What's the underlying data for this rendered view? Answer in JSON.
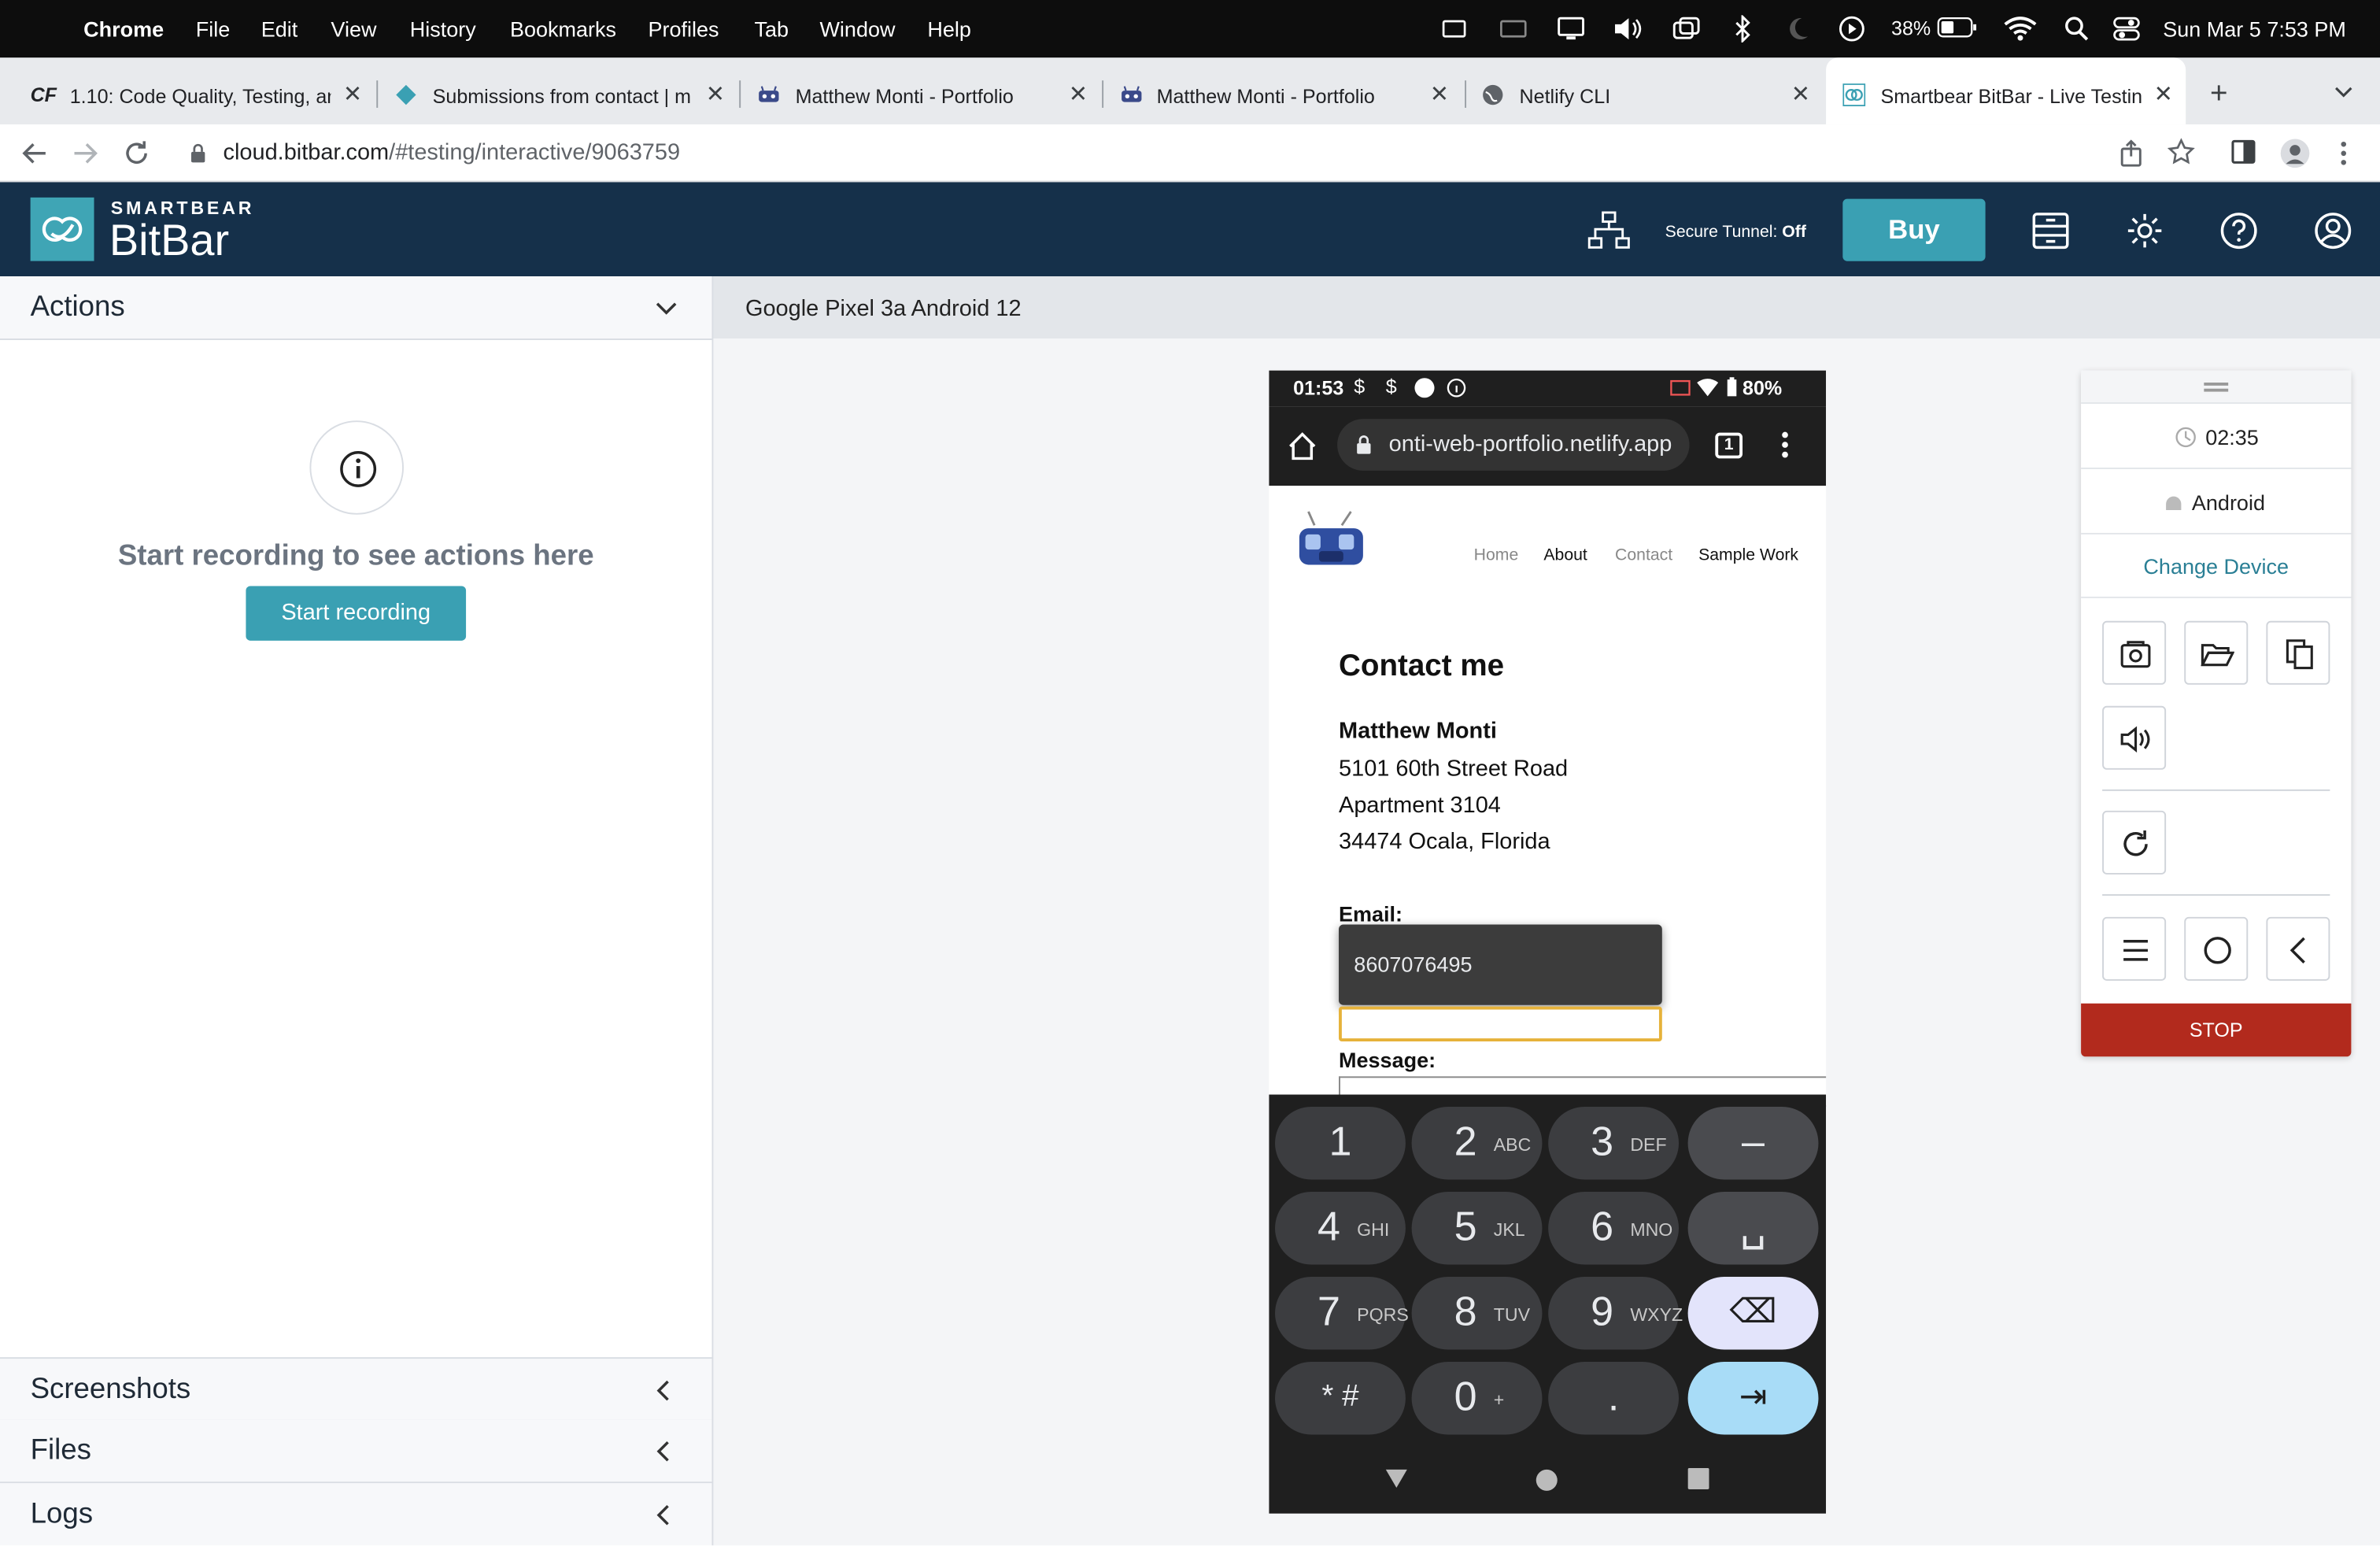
{
  "menubar": {
    "app": "Chrome",
    "items": [
      "File",
      "Edit",
      "View",
      "History",
      "Bookmarks",
      "Profiles",
      "Tab",
      "Window",
      "Help"
    ],
    "battery": "38%",
    "datetime": "Sun Mar 5  7:53 PM"
  },
  "tabs": [
    {
      "title": "1.10: Code Quality, Testing, an",
      "favicon": "CF"
    },
    {
      "title": "Submissions from contact | m"
    },
    {
      "title": "Matthew Monti - Portfolio"
    },
    {
      "title": "Matthew Monti - Portfolio"
    },
    {
      "title": "Netlify CLI"
    },
    {
      "title": "Smartbear BitBar - Live Testin"
    }
  ],
  "address": {
    "host": "cloud.bitbar.com",
    "path": "/#testing/interactive/9063759"
  },
  "header": {
    "brand_small": "SMARTBEAR",
    "brand_big": "BitBar",
    "tunnel_label": "Secure Tunnel:",
    "tunnel_state": "Off",
    "buy_label": "Buy"
  },
  "left_panel": {
    "actions_label": "Actions",
    "empty_message": "Start recording to see actions here",
    "start_button": "Start recording",
    "screenshots_label": "Screenshots",
    "files_label": "Files",
    "logs_label": "Logs"
  },
  "device": {
    "name": "Google Pixel 3a Android 12",
    "status_time": "01:53",
    "status_battery": "80%",
    "url": "onti-web-portfolio.netlify.app",
    "tab_count": "1",
    "nav": [
      "Home",
      "About",
      "Contact",
      "Sample Work"
    ],
    "page_title": "Contact me",
    "contact_name": "Matthew Monti",
    "address_lines": [
      "5101 60th Street Road",
      "Apartment 3104",
      "34474 Ocala, Florida"
    ],
    "email_label": "Email:",
    "autofill_value": "8607076495",
    "message_label": "Message:",
    "keys": [
      {
        "main": "1",
        "sub": ""
      },
      {
        "main": "2",
        "sub": "ABC"
      },
      {
        "main": "3",
        "sub": "DEF"
      },
      {
        "main": "–",
        "sub": ""
      },
      {
        "main": "4",
        "sub": "GHI"
      },
      {
        "main": "5",
        "sub": "JKL"
      },
      {
        "main": "6",
        "sub": "MNO"
      },
      {
        "main": "␣",
        "sub": ""
      },
      {
        "main": "7",
        "sub": "PQRS"
      },
      {
        "main": "8",
        "sub": "TUV"
      },
      {
        "main": "9",
        "sub": "WXYZ"
      },
      {
        "main": "⌫",
        "sub": ""
      },
      {
        "main": "* #",
        "sub": ""
      },
      {
        "main": "0",
        "sub": "+"
      },
      {
        "main": ".",
        "sub": ""
      },
      {
        "main": "⇥",
        "sub": ""
      }
    ]
  },
  "controls": {
    "timer": "02:35",
    "os": "Android",
    "change_device": "Change Device",
    "stop_label": "STOP"
  }
}
